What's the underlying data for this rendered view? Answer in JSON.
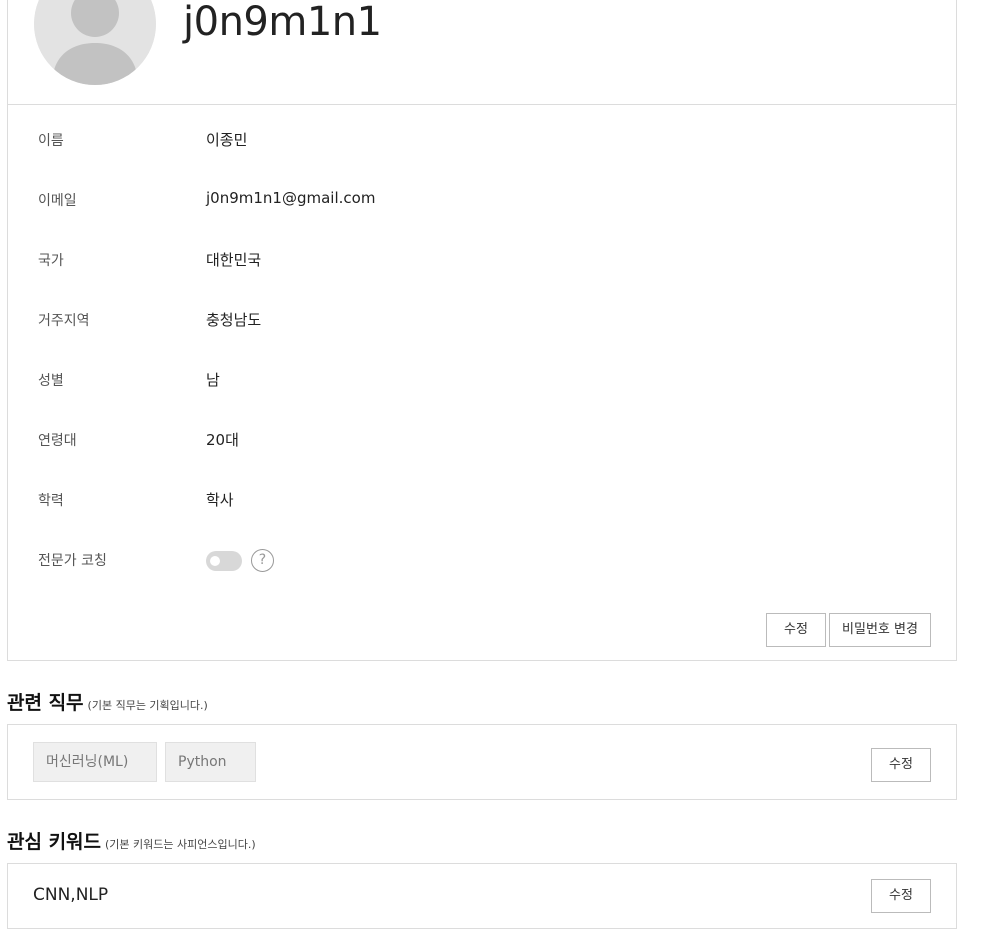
{
  "profile": {
    "username": "j0n9m1n1",
    "fields": [
      {
        "label": "이름",
        "value": "이종민"
      },
      {
        "label": "이메일",
        "value": "j0n9m1n1@gmail.com"
      },
      {
        "label": "국가",
        "value": "대한민국"
      },
      {
        "label": "거주지역",
        "value": "충청남도"
      },
      {
        "label": "성별",
        "value": "남"
      },
      {
        "label": "연령대",
        "value": "20대"
      },
      {
        "label": "학력",
        "value": "학사"
      }
    ],
    "coaching_label": "전문가 코칭",
    "coaching_enabled": false,
    "help_icon_glyph": "?",
    "edit_label": "수정",
    "change_password_label": "비밀번호 변경"
  },
  "jobs": {
    "title": "관련 직무",
    "note": "(기본 직무는 기획입니다.)",
    "tags": [
      "머신러닝(ML)",
      "Python"
    ],
    "edit_label": "수정"
  },
  "keywords": {
    "title": "관심 키워드",
    "note": "(기본 키워드는 사피언스입니다.)",
    "value": "CNN,NLP",
    "edit_label": "수정"
  },
  "colors": {
    "border": "#dcdcdc",
    "avatar_bg": "#e3e3e3",
    "avatar_fg": "#c2c2c2",
    "toggle_off": "#d8d8d8"
  }
}
